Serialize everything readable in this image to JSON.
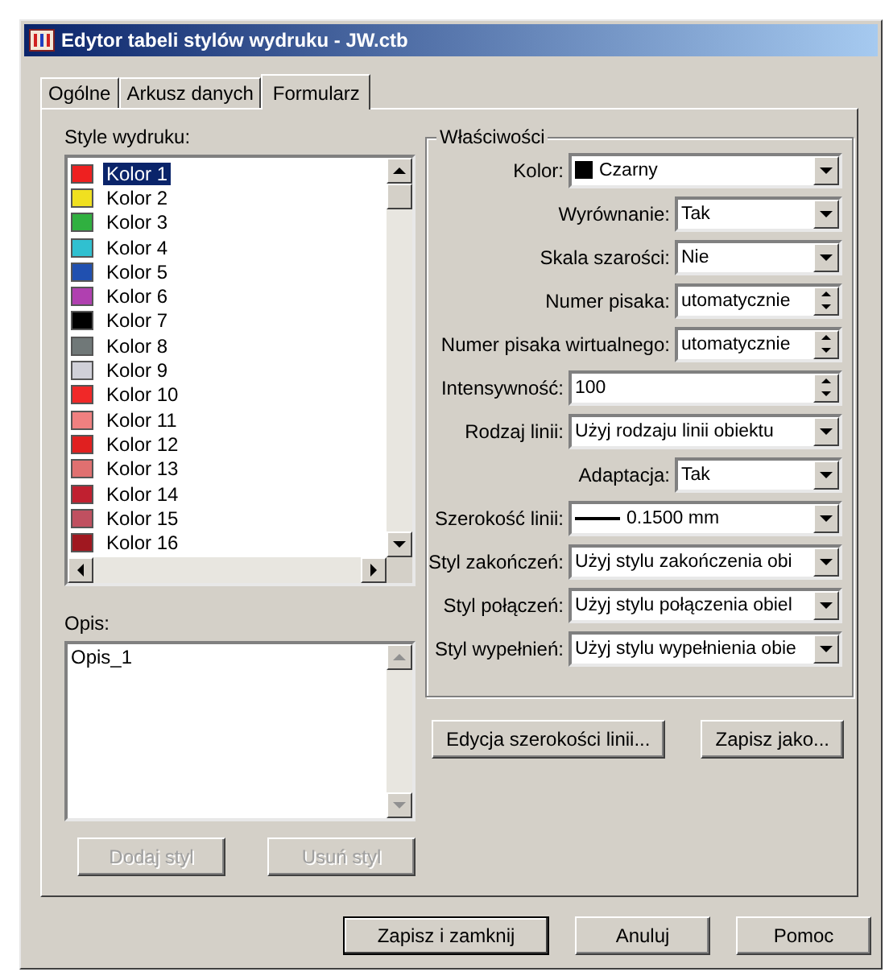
{
  "window": {
    "title": "Edytor tabeli stylów wydruku - JW.ctb"
  },
  "tabs": [
    {
      "label": "Ogólne",
      "selected": false
    },
    {
      "label": "Arkusz danych",
      "selected": false
    },
    {
      "label": "Formularz",
      "selected": true
    }
  ],
  "styles": {
    "label": "Style wydruku:",
    "items": [
      {
        "name": "Kolor 1",
        "color": "#ee2020",
        "selected": true
      },
      {
        "name": "Kolor 2",
        "color": "#f0e020",
        "selected": false
      },
      {
        "name": "Kolor 3",
        "color": "#30b040",
        "selected": false
      },
      {
        "name": "Kolor 4",
        "color": "#30c0d0",
        "selected": false
      },
      {
        "name": "Kolor 5",
        "color": "#2050b0",
        "selected": false
      },
      {
        "name": "Kolor 6",
        "color": "#b040b0",
        "selected": false
      },
      {
        "name": "Kolor 7",
        "color": "#000000",
        "selected": false
      },
      {
        "name": "Kolor 8",
        "color": "#707878",
        "selected": false
      },
      {
        "name": "Kolor 9",
        "color": "#d0d0d8",
        "selected": false
      },
      {
        "name": "Kolor 10",
        "color": "#f02828",
        "selected": false
      },
      {
        "name": "Kolor 11",
        "color": "#f08080",
        "selected": false
      },
      {
        "name": "Kolor 12",
        "color": "#e02020",
        "selected": false
      },
      {
        "name": "Kolor 13",
        "color": "#e07070",
        "selected": false
      },
      {
        "name": "Kolor 14",
        "color": "#c02030",
        "selected": false
      },
      {
        "name": "Kolor 15",
        "color": "#c05060",
        "selected": false
      },
      {
        "name": "Kolor 16",
        "color": "#a01820",
        "selected": false
      }
    ]
  },
  "description": {
    "label": "Opis:",
    "value": "Opis_1"
  },
  "style_buttons": [
    {
      "label": "Dodaj styl",
      "disabled": true
    },
    {
      "label": "Usuń styl",
      "disabled": true
    }
  ],
  "properties": {
    "title": "Właściwości",
    "rows": [
      {
        "label": "Kolor:",
        "value": "Czarny",
        "kind": "color-combo",
        "color": "#000000"
      },
      {
        "label": "Wyrównanie:",
        "value": "Tak",
        "kind": "short-combo"
      },
      {
        "label": "Skala szarości:",
        "value": "Nie",
        "kind": "short-combo"
      },
      {
        "label": "Numer pisaka:",
        "value": "utomatycznie",
        "kind": "short-spin"
      },
      {
        "label": "Numer pisaka wirtualnego:",
        "value": "utomatycznie",
        "kind": "short-spin"
      },
      {
        "label": "Intensywność:",
        "value": "100",
        "kind": "spin"
      },
      {
        "label": "Rodzaj linii:",
        "value": "Użyj rodzaju linii obiektu",
        "kind": "combo"
      },
      {
        "label": "Adaptacja:",
        "value": "Tak",
        "kind": "short-combo"
      },
      {
        "label": "Szerokość linii:",
        "value": "0.1500 mm",
        "kind": "line-combo"
      },
      {
        "label": "Styl zakończeń:",
        "value": "Użyj stylu zakończenia obi",
        "kind": "combo"
      },
      {
        "label": "Styl połączeń:",
        "value": "Użyj stylu połączenia obiel",
        "kind": "combo"
      },
      {
        "label": "Styl wypełnień:",
        "value": "Użyj stylu wypełnienia obie",
        "kind": "combo"
      }
    ]
  },
  "property_buttons": [
    "Edycja szerokości linii...",
    "Zapisz jako..."
  ],
  "dialog_buttons": [
    {
      "label": "Zapisz i zamknij",
      "default": true
    },
    {
      "label": "Anuluj",
      "default": false
    },
    {
      "label": "Pomoc",
      "default": false
    }
  ]
}
